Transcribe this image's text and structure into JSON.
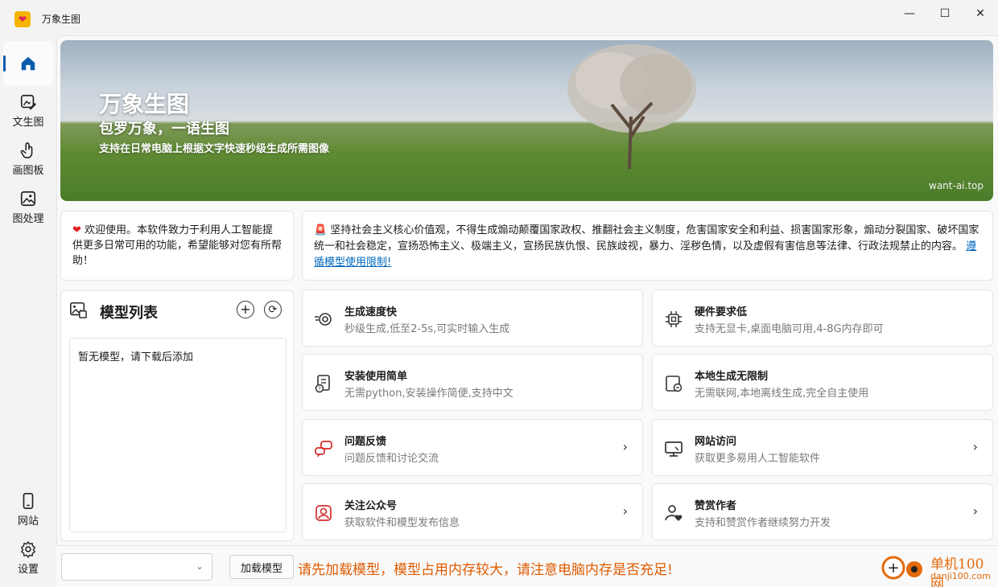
{
  "window": {
    "title": "万象生图",
    "minimize": "—",
    "maximize": "☐",
    "close": "✕"
  },
  "sidebar": {
    "items": [
      {
        "label": "",
        "icon": "home-icon",
        "active": true
      },
      {
        "label": "文生图",
        "icon": "image-edit-icon"
      },
      {
        "label": "画图板",
        "icon": "hand-draw-icon"
      },
      {
        "label": "图处理",
        "icon": "image-icon"
      },
      {
        "label": "网站",
        "icon": "phone-icon"
      },
      {
        "label": "设置",
        "icon": "gear-icon"
      }
    ]
  },
  "banner": {
    "title": "万象生图",
    "subtitle": "包罗万象，一语生图",
    "description": "支持在日常电脑上根据文字快速秒级生成所需图像",
    "watermark": "want-ai.top"
  },
  "welcome": {
    "icon": "heart-icon",
    "text": "欢迎使用。本软件致力于利用人工智能提供更多日常可用的功能，希望能够对您有所帮助！"
  },
  "notice": {
    "icon": "alarm-icon",
    "text": "坚持社会主义核心价值观，不得生成煽动颠覆国家政权、推翻社会主义制度，危害国家安全和利益、损害国家形象，煽动分裂国家、破坏国家统一和社会稳定，宣扬恐怖主义、极端主义，宣扬民族仇恨、民族歧视，暴力、淫秽色情，以及虚假有害信息等法律、行政法规禁止的内容。",
    "link": "遵循模型使用限制!"
  },
  "model_panel": {
    "title": "模型列表",
    "add": "+",
    "refresh": "⟳",
    "empty": "暂无模型，请下载后添加"
  },
  "features": [
    {
      "title": "生成速度快",
      "desc": "秒级生成,低至2-5s,可实时输入生成",
      "icon": "speed-icon",
      "chevron": ""
    },
    {
      "title": "硬件要求低",
      "desc": "支持无显卡,桌面电脑可用,4-8G内存即可",
      "icon": "chip-icon",
      "chevron": ""
    },
    {
      "title": "安装使用简单",
      "desc": "无需python,安装操作简便,支持中文",
      "icon": "install-icon",
      "chevron": ""
    },
    {
      "title": "本地生成无限制",
      "desc": "无需联网,本地离线生成,完全自主使用",
      "icon": "local-icon",
      "chevron": ""
    },
    {
      "title": "问题反馈",
      "desc": "问题反馈和讨论交流",
      "icon": "chat-icon",
      "chevron": "›"
    },
    {
      "title": "网站访问",
      "desc": "获取更多易用人工智能软件",
      "icon": "monitor-icon",
      "chevron": "›"
    },
    {
      "title": "关注公众号",
      "desc": "获取软件和模型发布信息",
      "icon": "wechat-icon",
      "chevron": "›"
    },
    {
      "title": "赞赏作者",
      "desc": "支持和赞赏作者继续努力开发",
      "icon": "reward-icon",
      "chevron": "›"
    }
  ],
  "bottom": {
    "model_select_value": "",
    "caret": "⌄",
    "load_button": "加载模型",
    "warning": "请先加载模型，模型占用内存较大，请注意电脑内存是否充足!"
  },
  "corner_watermark": {
    "title": "单机100网",
    "url": "danji100.com"
  },
  "colors": {
    "accent": "#0b5cad",
    "warning": "#e05a00",
    "red": "#e02020",
    "link": "#0067c0"
  }
}
